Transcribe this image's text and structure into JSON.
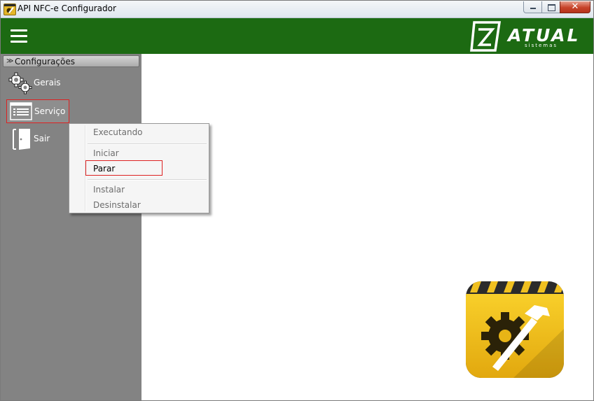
{
  "window": {
    "title": "API NFC-e Configurador",
    "controls": {
      "minimize": "minimize",
      "maximize": "maximize",
      "close": "✕"
    }
  },
  "header": {
    "menu_icon": "hamburger-icon",
    "logo": {
      "word": "ATUAL",
      "sub": "sistemas"
    }
  },
  "sidebar": {
    "section_label": "Configurações",
    "section_icon": "double-chevron-down-icon",
    "items": [
      {
        "label": "Gerais",
        "icon": "gears-icon"
      },
      {
        "label": "Serviço",
        "icon": "service-window-icon",
        "selected": true
      },
      {
        "label": "Sair",
        "icon": "door-icon"
      }
    ]
  },
  "context_menu": {
    "items": [
      {
        "label": "Executando",
        "enabled": false
      },
      {
        "label": "Iniciar",
        "enabled": false
      },
      {
        "label": "Parar",
        "enabled": true,
        "highlighted": true
      },
      {
        "label": "Instalar",
        "enabled": false
      },
      {
        "label": "Desinstalar",
        "enabled": false
      }
    ]
  },
  "colors": {
    "header_green": "#1c6a12",
    "sidebar_gray": "#838383",
    "highlight_red": "#dd2222",
    "badge_yellow": "#f2c21c"
  },
  "badge_icon": "hammer-gear-icon"
}
